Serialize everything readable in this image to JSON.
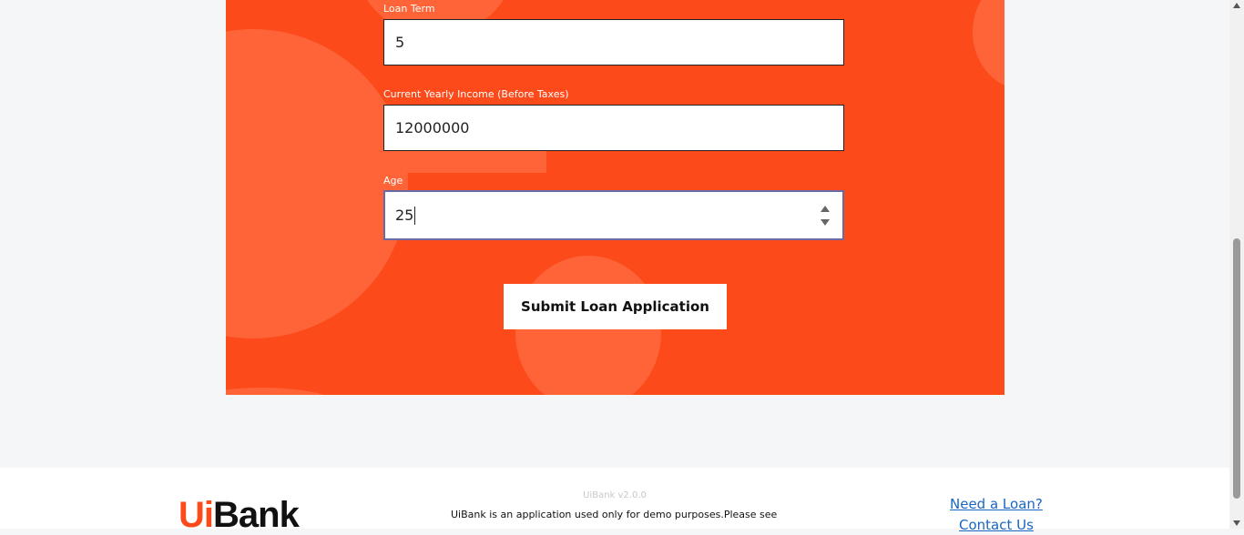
{
  "form": {
    "loan_term": {
      "label": "Loan Term",
      "value": "5"
    },
    "income": {
      "label": "Current Yearly Income (Before Taxes)",
      "value": "12000000"
    },
    "age": {
      "label": "Age",
      "value": "25"
    },
    "submit_label": "Submit Loan Application"
  },
  "footer": {
    "logo_ui": "Ui",
    "logo_bank": "Bank",
    "version": "UiBank v2.0.0",
    "note": "UiBank is an application used only for demo purposes.Please see",
    "link_loan": "Need a Loan?",
    "link_contact": "Contact Us"
  },
  "colors": {
    "brand": "#fc4a1a",
    "brand_light": "#ff6438",
    "link": "#1a66c2"
  }
}
